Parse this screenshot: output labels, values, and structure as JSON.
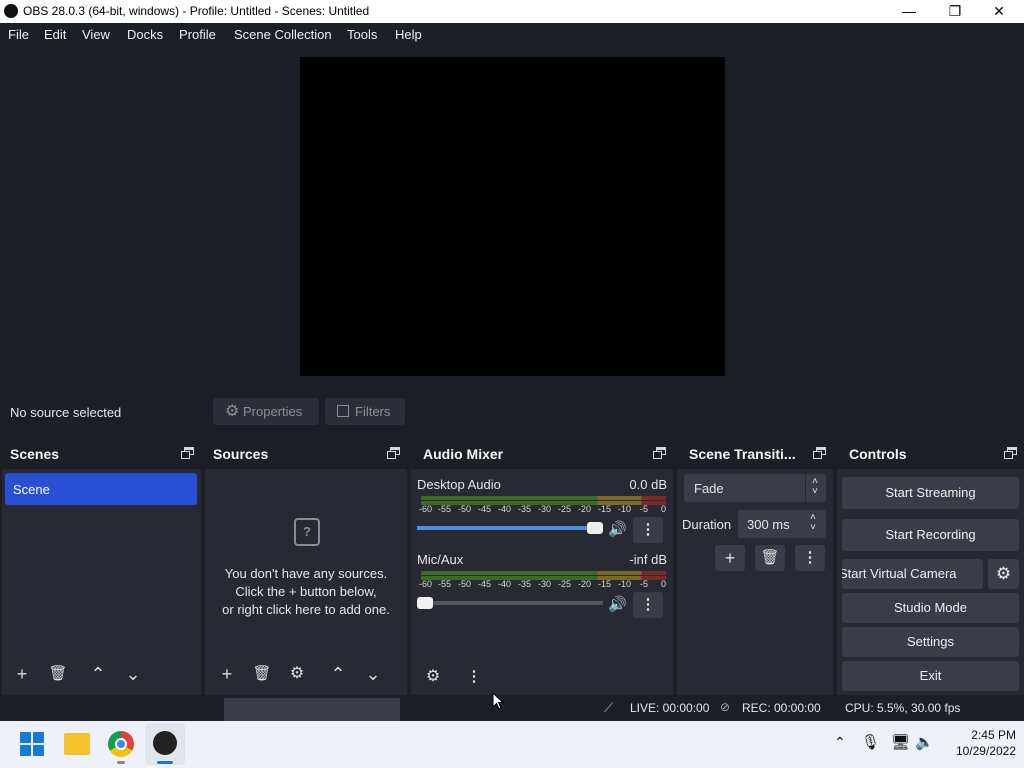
{
  "window": {
    "title": "OBS 28.0.3 (64-bit, windows) - Profile: Untitled - Scenes: Untitled",
    "min": "—",
    "max": "❐",
    "close": "✕"
  },
  "menu": [
    "File",
    "Edit",
    "View",
    "Docks",
    "Profile",
    "Scene Collection",
    "Tools",
    "Help"
  ],
  "source_bar": {
    "status": "No source selected",
    "properties": "Properties",
    "filters": "Filters"
  },
  "scenes": {
    "title": "Scenes",
    "items": [
      "Scene"
    ]
  },
  "sources": {
    "title": "Sources",
    "empty_line1": "You don't have any sources.",
    "empty_line2": "Click the + button below,",
    "empty_line3": "or right click here to add one."
  },
  "audio": {
    "title": "Audio Mixer",
    "ticks": [
      "-60",
      "-55",
      "-50",
      "-45",
      "-40",
      "-35",
      "-30",
      "-25",
      "-20",
      "-15",
      "-10",
      "-5",
      "0"
    ],
    "channels": [
      {
        "name": "Desktop Audio",
        "level": "0.0 dB",
        "volume": 1.0
      },
      {
        "name": "Mic/Aux",
        "level": "-inf dB",
        "volume": 0.0
      }
    ]
  },
  "transitions": {
    "title": "Scene Transiti...",
    "selected": "Fade",
    "duration_label": "Duration",
    "duration_value": "300 ms"
  },
  "controls": {
    "title": "Controls",
    "start_streaming": "Start Streaming",
    "start_recording": "Start Recording",
    "start_virtual_camera": "Start Virtual Camera",
    "studio_mode": "Studio Mode",
    "settings": "Settings",
    "exit": "Exit"
  },
  "status": {
    "live": "LIVE: 00:00:00",
    "rec": "REC: 00:00:00",
    "cpu": "CPU: 5.5%, 30.00 fps"
  },
  "taskbar": {
    "time": "2:45 PM",
    "date": "10/29/2022"
  },
  "colors": {
    "accent": "#2a4fd4",
    "background": "#1d1f26",
    "panel": "#272a33",
    "button": "#3a3d48"
  }
}
